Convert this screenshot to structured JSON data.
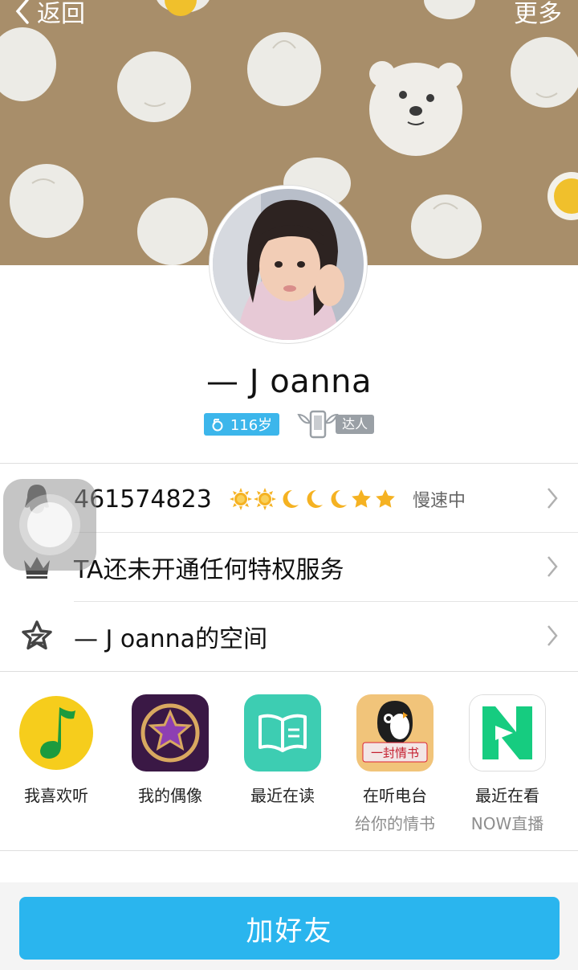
{
  "topbar": {
    "back_label": "返回",
    "more_label": "更多"
  },
  "profile": {
    "name": "— J oanna",
    "age_badge": "116岁",
    "daren_label": "达人"
  },
  "rows": {
    "qq_number": "461574823",
    "speed_text": "慢速中",
    "privilege_text": "TA还未开通任何特权服务",
    "space_text": "— J oanna的空间"
  },
  "level_icons": [
    "sun-icon",
    "sun-icon",
    "moon-icon",
    "moon-icon",
    "moon-icon",
    "star-icon",
    "star-icon"
  ],
  "apps": [
    {
      "title": "我喜欢听",
      "subtitle": ""
    },
    {
      "title": "我的偶像",
      "subtitle": ""
    },
    {
      "title": "最近在读",
      "subtitle": ""
    },
    {
      "title": "在听电台",
      "subtitle": "给你的情书"
    },
    {
      "title": "最近在看",
      "subtitle": "NOW直播"
    }
  ],
  "app_tile_text": {
    "radio_banner": "一封情书"
  },
  "actions": {
    "add_friend_label": "加好友"
  },
  "colors": {
    "accent": "#2ab5ee",
    "cover_bg": "#a88e6a",
    "age_badge": "#3cb6eb"
  }
}
